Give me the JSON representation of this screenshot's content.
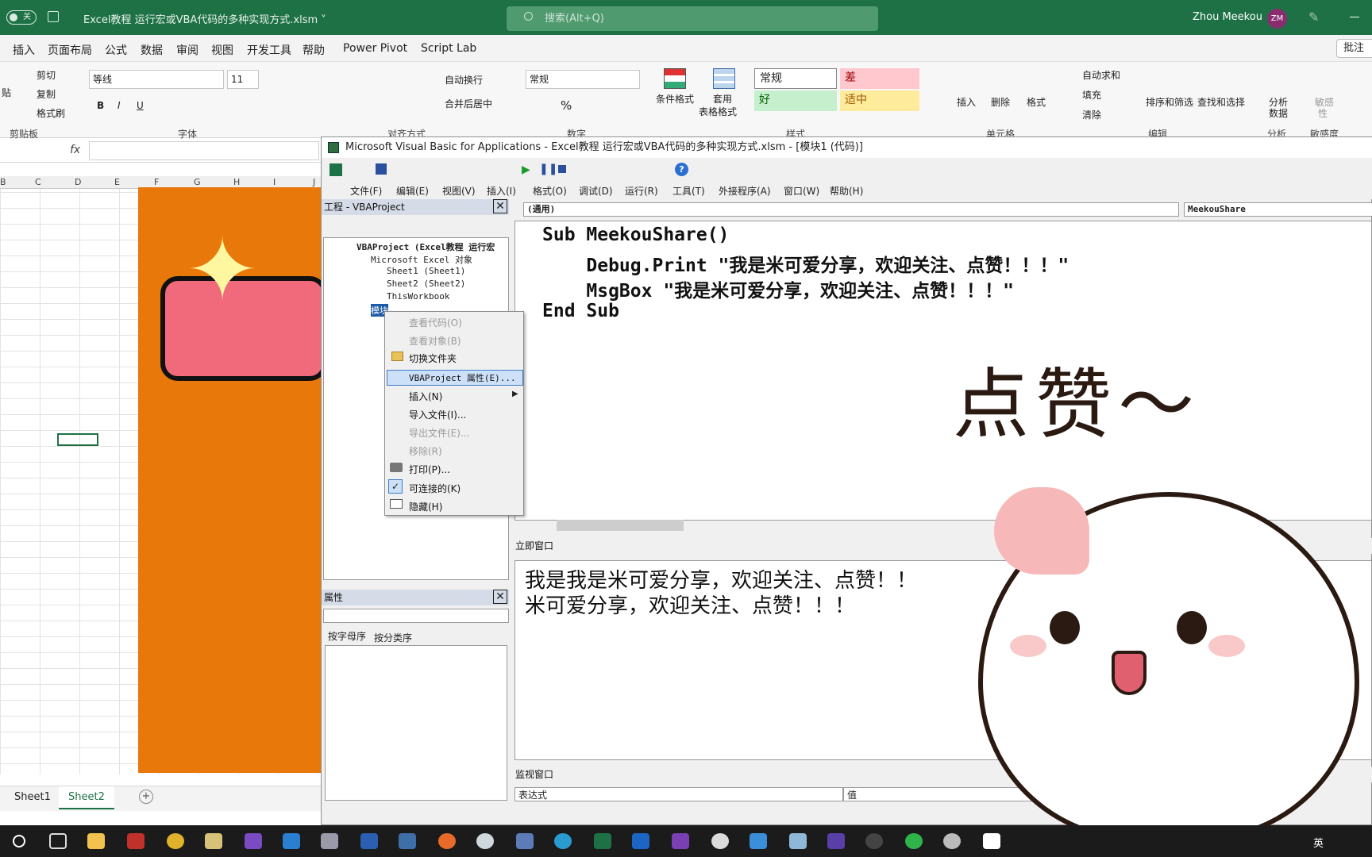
{
  "window": {
    "toggle_label": "关",
    "file_title": "Excel教程 运行宏或VBA代码的多种实现方式.xlsm ˅",
    "search_placeholder": "搜索(Alt+Q)",
    "user_name": "Zhou Meekou",
    "user_initials": "ZM"
  },
  "menu_tabs": [
    "插入",
    "页面布局",
    "公式",
    "数据",
    "审阅",
    "视图",
    "开发工具",
    "帮助",
    "Power Pivot",
    "Script Lab"
  ],
  "comment_button": "批注",
  "ribbon": {
    "clipboard": {
      "paste": "贴",
      "cut": "剪切",
      "copy": "复制",
      "format_painter": "格式刷",
      "group": "剪贴板"
    },
    "font": {
      "name": "等线",
      "size": "11",
      "bold": "B",
      "italic": "I",
      "underline": "U",
      "group": "字体"
    },
    "align": {
      "wrap": "自动换行",
      "merge": "合并后居中",
      "group": "对齐方式"
    },
    "number": {
      "format": "常规",
      "group": "数字"
    },
    "styles": {
      "cond": "条件格式",
      "table_line1": "套用",
      "table_line2": "表格格式",
      "normal": "常规",
      "bad": "差",
      "good": "好",
      "neutral": "适中",
      "group": "样式"
    },
    "cells": {
      "insert": "插入",
      "delete": "删除",
      "format": "格式",
      "group": "单元格"
    },
    "editing": {
      "autosum": "自动求和",
      "fill": "填充",
      "clear": "清除",
      "sort": "排序和筛选",
      "find": "查找和选择",
      "group": "编辑"
    },
    "analysis": {
      "line1": "分析",
      "line2": "数据",
      "group": "分析"
    },
    "sensitivity": {
      "line1": "敏感",
      "line2": "性",
      "group": "敏感度"
    }
  },
  "columns": [
    "B",
    "C",
    "D",
    "E",
    "F",
    "G",
    "H",
    "I",
    "J"
  ],
  "sheet_tabs": [
    "Sheet1",
    "Sheet2"
  ],
  "vbe": {
    "title": "Microsoft Visual Basic for Applications - Excel教程 运行宏或VBA代码的多种实现方式.xlsm - [模块1 (代码)]",
    "menus": [
      "文件(F)",
      "编辑(E)",
      "视图(V)",
      "插入(I)",
      "格式(O)",
      "调试(D)",
      "运行(R)",
      "工具(T)",
      "外接程序(A)",
      "窗口(W)",
      "帮助(H)"
    ],
    "project_title": "工程 - VBAProject",
    "tree": [
      "VBAProject (Excel教程 运行宏",
      "Microsoft Excel 对象",
      "Sheet1 (Sheet1)",
      "Sheet2 (Sheet2)",
      "ThisWorkbook",
      "模块"
    ],
    "properties_title": "属性",
    "prop_tab_alpha": "按字母序",
    "prop_tab_cat": "按分类序",
    "object_combo": "(通用)",
    "proc_combo": "MeekouShare",
    "code": [
      "Sub MeekouShare()",
      "    Debug.Print \"我是米可爱分享，欢迎关注、点赞！！！\"",
      "    MsgBox \"我是米可爱分享，欢迎关注、点赞！！！\"",
      "End Sub"
    ],
    "immediate_title": "立即窗口",
    "immediate": [
      "我是我是米可爱分享，欢迎关注、点赞！！",
      "米可爱分享，欢迎关注、点赞！！！"
    ],
    "watch_title": "监视窗口",
    "watch_col1": "表达式",
    "watch_col2": "值"
  },
  "context_menu": [
    "查看代码(O)",
    "查看对象(B)",
    "切换文件夹",
    "VBAProject 属性(E)...",
    "插入(N)",
    "导入文件(I)...",
    "导出文件(E)...",
    "移除(R)",
    "打印(P)...",
    "可连接的(K)",
    "隐藏(H)"
  ],
  "sticker_text": "点赞～",
  "taskbar": {
    "ime": "英"
  }
}
